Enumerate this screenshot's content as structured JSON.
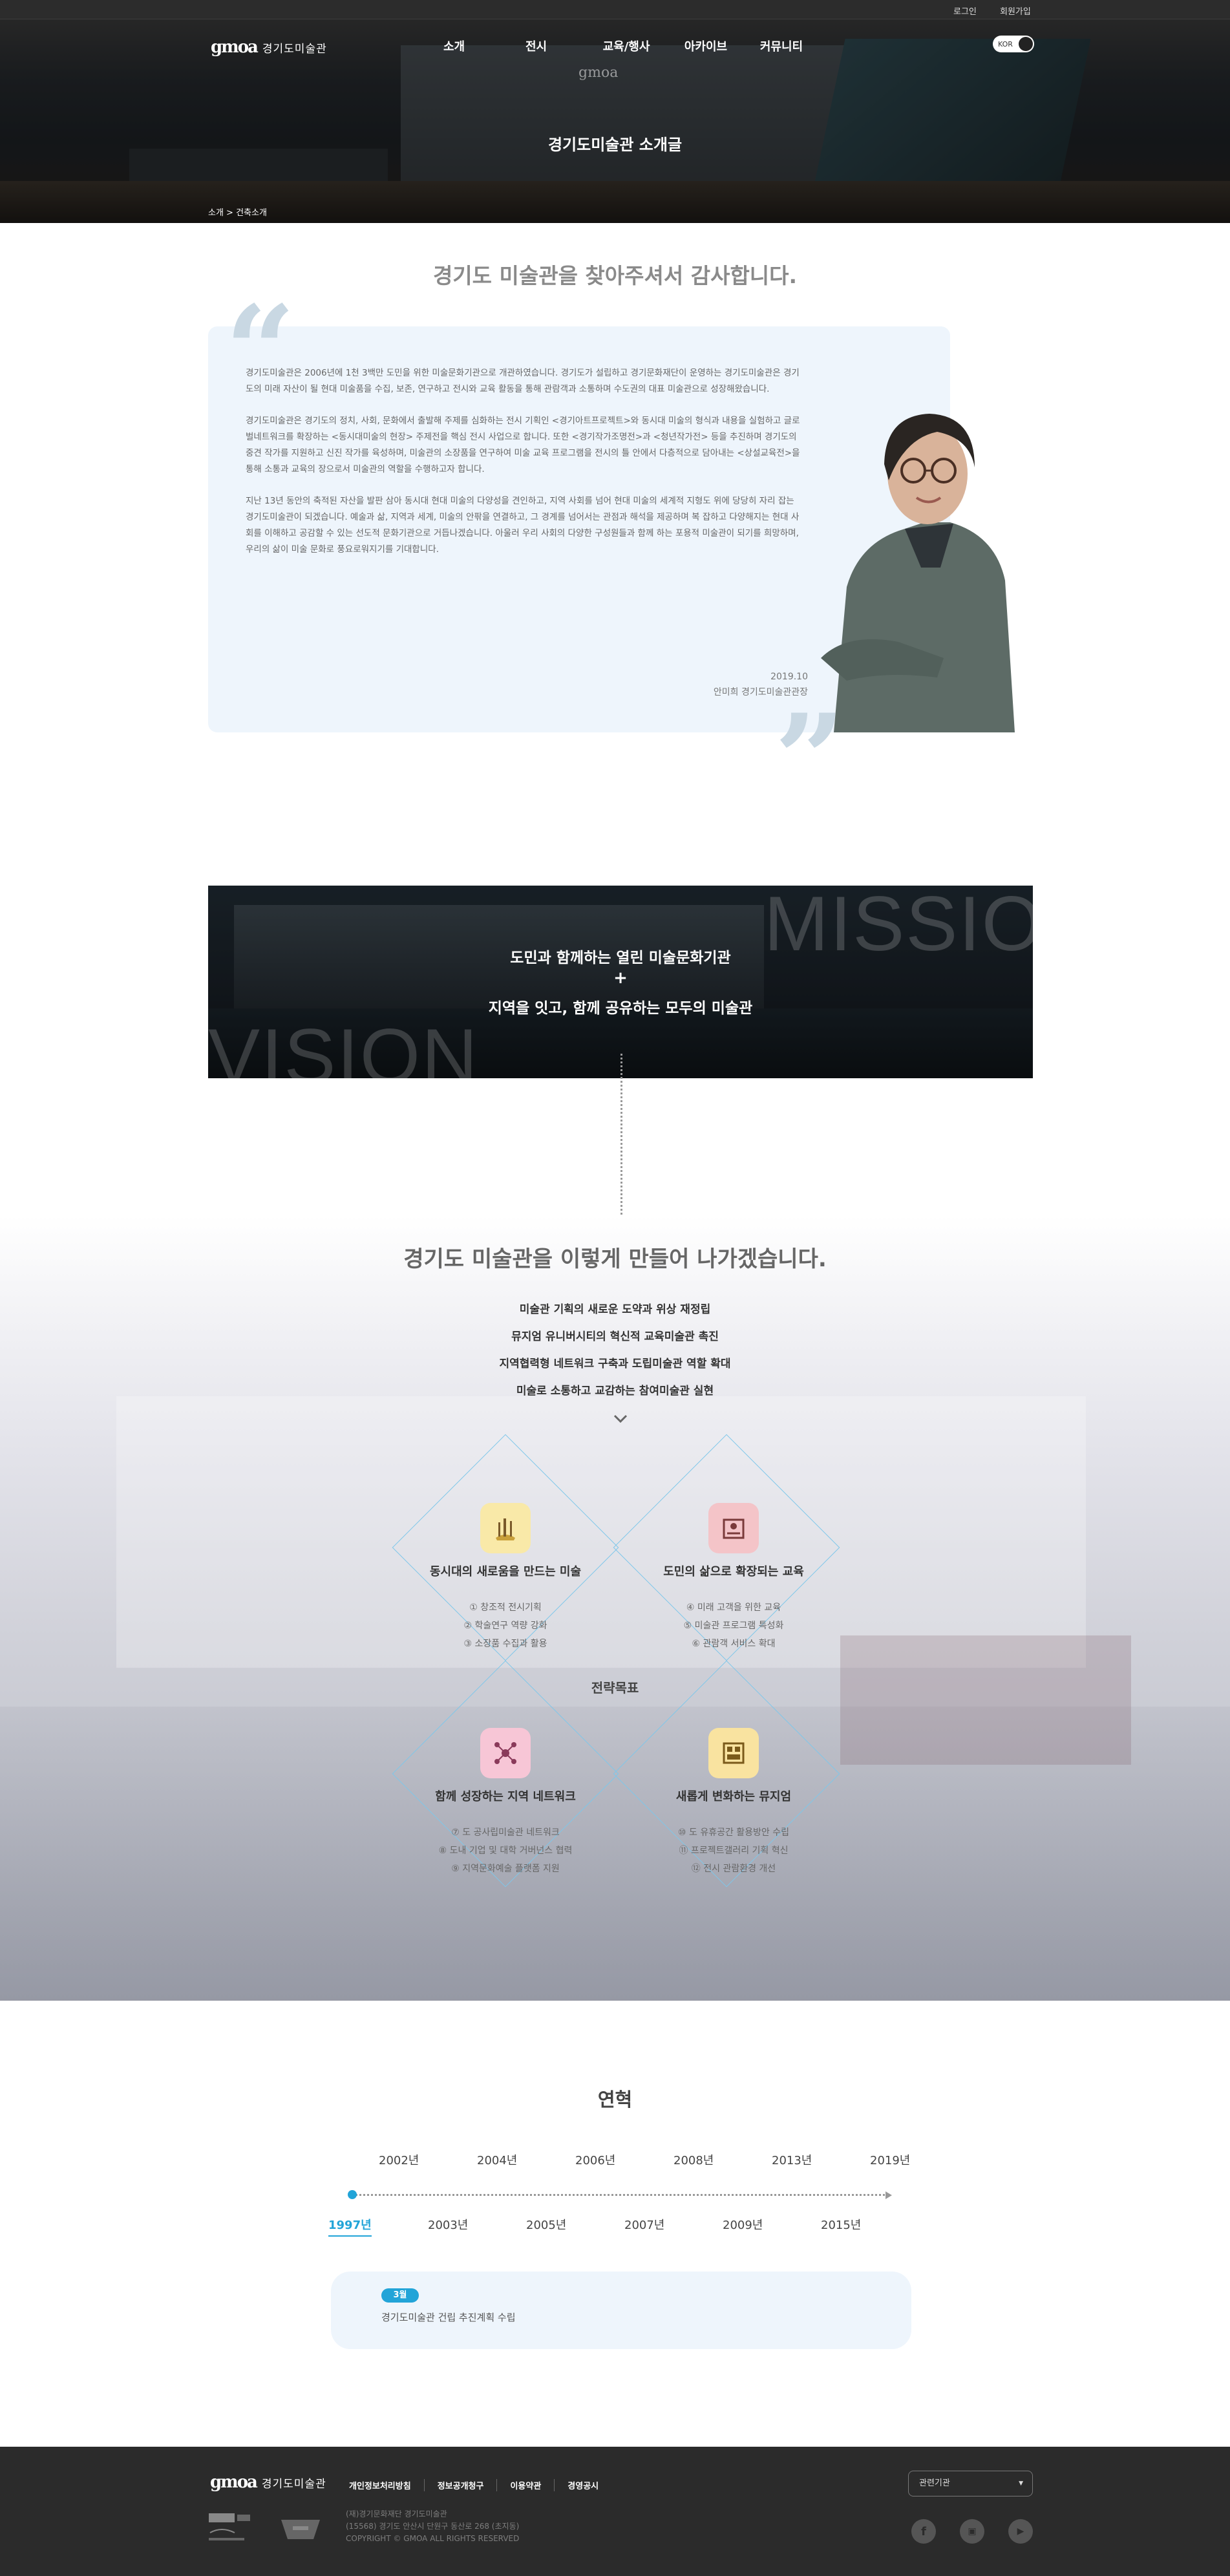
{
  "util": {
    "login": "로그인",
    "join": "회원가입"
  },
  "logo": {
    "mark": "gmoa",
    "name": "경기도미술관"
  },
  "gnb": [
    "소개",
    "전시",
    "교육/행사",
    "아카이브",
    "커뮤니티"
  ],
  "lang": "KOR",
  "hero": {
    "title": "경기도미술관 소개글",
    "breadcrumb": "소개 > 건축소개"
  },
  "greeting": {
    "heading": "경기도 미술관을 찾아주셔서 감사합니다.",
    "paragraphs": [
      "경기도미술관은 2006년에 1천 3백만 도민을 위한 미술문화기관으로 개관하였습니다. 경기도가 설립하고 경기문화재단이 운영하는 경기도미술관은 경기도의 미래 자산이 될 현대 미술품을 수집, 보존, 연구하고 전시와 교육 활동을 통해 관람객과 소통하며 수도권의 대표 미술관으로 성장해왔습니다.",
      "경기도미술관은 경기도의 정치, 사회, 문화에서 출발해 주제를 심화하는 전시 기획인 <경기아트프로젝트>와 동시대 미술의 형식과 내용을 실험하고 글로벌네트워크를 확장하는 <동시대미술의 현장> 주제전을 핵심 전시 사업으로 합니다. 또한 <경기작가조명전>과 <청년작가전> 등을 추진하며 경기도의 중견 작가를 지원하고 신진 작가를 육성하며, 미술관의 소장품을 연구하여 미술 교육 프로그램을 전시의 틀 안에서 다층적으로 담아내는 <상설교육전>을 통해 소통과 교육의 장으로서 미술관의 역할을 수행하고자 합니다.",
      "지난 13년 동안의 축적된 자산을 발판 삼아 동시대 현대 미술의 다양성을 견인하고, 지역 사회를 넘어 현대 미술의 세계적 지형도 위에 당당히 자리 잡는 경기도미술관이 되겠습니다. 예술과 삶, 지역과 세계, 미술의 안팎을 연결하고, 그 경계를 넘어서는 관점과 해석을 제공하며 복 잡하고 다양해지는 현대 사회를 이해하고 공감할 수 있는 선도적 문화기관으로 거듭나겠습니다. 아울러 우리 사회의 다양한 구성원들과 함께 하는 포용적 미술관이 되기를 희망하며, 우리의 삶이 미술 문화로 풍요로워지기를 기대합니다."
    ],
    "date": "2019.10",
    "signature": "안미희 경기도미술관관장"
  },
  "mission": {
    "watermark_top": "MISSION",
    "watermark_bottom": "VISION",
    "line1": "도민과 함께하는 열린 미술문화기관",
    "plus": "+",
    "line2": "지역을 잇고, 함께 공유하는 모두의 미술관"
  },
  "strategy": {
    "heading": "경기도 미술관을 이렇게 만들어 나가겠습니다.",
    "goals": [
      "미술관 기획의 새로운 도약과 위상 재정립",
      "뮤지엄 유니버시티의 혁신적 교육미술관 촉진",
      "지역협력형 네트워크 구축과 도립미술관 역할 확대",
      "미술로 소통하고 교감하는 참여미술관 실현"
    ],
    "center_label": "전략목표",
    "cards": [
      {
        "title": "동시대의 새로움을 만드는 미술",
        "items": [
          "① 창조적 전시기획",
          "② 학술연구 역량 강화",
          "③ 소장품 수집과 활용"
        ],
        "icon": "art-icon",
        "icon_bg": "#f9e9a8"
      },
      {
        "title": "도민의 삶으로 확장되는 교육",
        "items": [
          "④ 미래 고객을 위한 교육",
          "⑤ 미술관 프로그램 특성화",
          "⑥ 관람객 서비스 확대"
        ],
        "icon": "education-icon",
        "icon_bg": "#f4c4c8"
      },
      {
        "title": "함께 성장하는 지역 네트워크",
        "items": [
          "⑦ 도 공사립미술관 네트워크",
          "⑧ 도내 기업 및 대학 거버넌스 협력",
          "⑨ 지역문화예술 플랫폼 지원"
        ],
        "icon": "network-icon",
        "icon_bg": "#f7c6d6"
      },
      {
        "title": "새롭게 변화하는 뮤지엄",
        "items": [
          "⑩ 도 유휴공간 활용방안 수립",
          "⑪ 프로젝트갤러리 기획 혁신",
          "⑫ 전시 관람환경 개선"
        ],
        "icon": "museum-icon",
        "icon_bg": "#f9e3a0"
      }
    ]
  },
  "history": {
    "heading": "연혁",
    "years_top": [
      "2002년",
      "2004년",
      "2006년",
      "2008년",
      "2013년",
      "2019년"
    ],
    "years_bottom": [
      "1997년",
      "2003년",
      "2005년",
      "2007년",
      "2009년",
      "2015년"
    ],
    "active_year": "1997년",
    "entry_month": "3월",
    "entry_text": "경기도미술관 건립 추진계획 수립"
  },
  "footer": {
    "links": [
      "개인정보처리방침",
      "정보공개청구",
      "이용약관",
      "경영공시"
    ],
    "info": [
      "(재)경기문화재단 경기도미술관",
      "(15568) 경기도 안산시 단원구 동산로 268 (초지동)",
      "COPYRIGHT © GMOA ALL RIGHTS RESERVED"
    ],
    "select_label": "관련기관",
    "social": [
      "f",
      "▣",
      "▶"
    ]
  },
  "colors": {
    "accent": "#22a4d8",
    "footer_bg": "#2b2b2b",
    "quote": "#c9d8e3"
  }
}
